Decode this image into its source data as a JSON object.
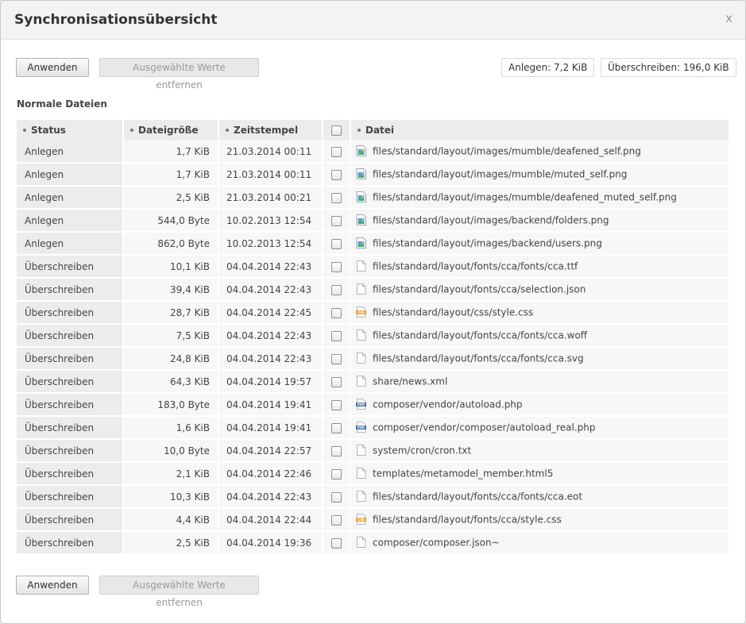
{
  "dialog": {
    "title": "Synchronisationsübersicht",
    "close_glyph": "x"
  },
  "toolbar": {
    "apply_label": "Anwenden",
    "remove_label": "Ausgewählte Werte entfernen",
    "stat_create": "Anlegen: 7,2 KiB",
    "stat_overwrite": "Überschreiben: 196,0 KiB"
  },
  "section": {
    "title": "Normale Dateien"
  },
  "table": {
    "headers": {
      "status": "Status",
      "size": "Dateigröße",
      "timestamp": "Zeitstempel",
      "file": "Datei"
    },
    "rows": [
      {
        "status": "Anlegen",
        "size": "1,7 KiB",
        "timestamp": "21.03.2014 00:11",
        "file": "files/standard/layout/images/mumble/deafened_self.png",
        "icon": "image"
      },
      {
        "status": "Anlegen",
        "size": "1,7 KiB",
        "timestamp": "21.03.2014 00:11",
        "file": "files/standard/layout/images/mumble/muted_self.png",
        "icon": "image"
      },
      {
        "status": "Anlegen",
        "size": "2,5 KiB",
        "timestamp": "21.03.2014 00:21",
        "file": "files/standard/layout/images/mumble/deafened_muted_self.png",
        "icon": "image"
      },
      {
        "status": "Anlegen",
        "size": "544,0 Byte",
        "timestamp": "10.02.2013 12:54",
        "file": "files/standard/layout/images/backend/folders.png",
        "icon": "image"
      },
      {
        "status": "Anlegen",
        "size": "862,0 Byte",
        "timestamp": "10.02.2013 12:54",
        "file": "files/standard/layout/images/backend/users.png",
        "icon": "image"
      },
      {
        "status": "Überschreiben",
        "size": "10,1 KiB",
        "timestamp": "04.04.2014 22:43",
        "file": "files/standard/layout/fonts/cca/fonts/cca.ttf",
        "icon": "file"
      },
      {
        "status": "Überschreiben",
        "size": "39,4 KiB",
        "timestamp": "04.04.2014 22:43",
        "file": "files/standard/layout/fonts/cca/selection.json",
        "icon": "file"
      },
      {
        "status": "Überschreiben",
        "size": "28,7 KiB",
        "timestamp": "04.04.2014 22:45",
        "file": "files/standard/layout/css/style.css",
        "icon": "css"
      },
      {
        "status": "Überschreiben",
        "size": "7,5 KiB",
        "timestamp": "04.04.2014 22:43",
        "file": "files/standard/layout/fonts/cca/fonts/cca.woff",
        "icon": "file"
      },
      {
        "status": "Überschreiben",
        "size": "24,8 KiB",
        "timestamp": "04.04.2014 22:43",
        "file": "files/standard/layout/fonts/cca/fonts/cca.svg",
        "icon": "file"
      },
      {
        "status": "Überschreiben",
        "size": "64,3 KiB",
        "timestamp": "04.04.2014 19:57",
        "file": "share/news.xml",
        "icon": "file"
      },
      {
        "status": "Überschreiben",
        "size": "183,0 Byte",
        "timestamp": "04.04.2014 19:41",
        "file": "composer/vendor/autoload.php",
        "icon": "php"
      },
      {
        "status": "Überschreiben",
        "size": "1,6 KiB",
        "timestamp": "04.04.2014 19:41",
        "file": "composer/vendor/composer/autoload_real.php",
        "icon": "php"
      },
      {
        "status": "Überschreiben",
        "size": "10,0 Byte",
        "timestamp": "04.04.2014 22:57",
        "file": "system/cron/cron.txt",
        "icon": "file"
      },
      {
        "status": "Überschreiben",
        "size": "2,1 KiB",
        "timestamp": "04.04.2014 22:46",
        "file": "templates/metamodel_member.html5",
        "icon": "file"
      },
      {
        "status": "Überschreiben",
        "size": "10,3 KiB",
        "timestamp": "04.04.2014 22:43",
        "file": "files/standard/layout/fonts/cca/fonts/cca.eot",
        "icon": "file"
      },
      {
        "status": "Überschreiben",
        "size": "4,4 KiB",
        "timestamp": "04.04.2014 22:44",
        "file": "files/standard/layout/fonts/cca/style.css",
        "icon": "css"
      },
      {
        "status": "Überschreiben",
        "size": "2,5 KiB",
        "timestamp": "04.04.2014 19:36",
        "file": "composer/composer.json~",
        "icon": "file"
      }
    ]
  },
  "icons": {
    "image": "image-file-icon",
    "file": "generic-file-icon",
    "css": "css-file-icon",
    "php": "php-file-icon"
  },
  "colors": {
    "header_bg": "#ececec",
    "row_bg": "#f7f7f7",
    "status_bg": "#ececec"
  }
}
